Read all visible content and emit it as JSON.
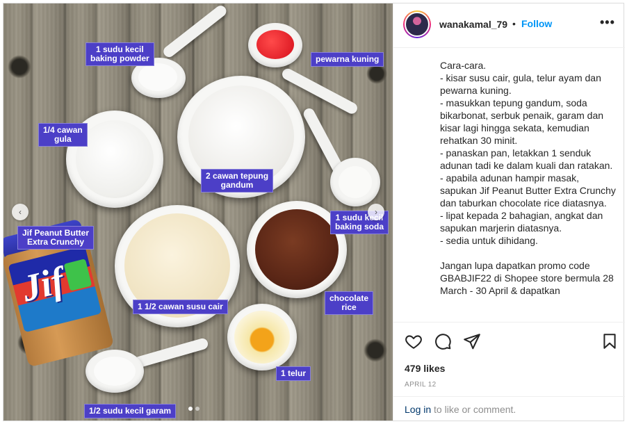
{
  "post": {
    "photo": {
      "labels": {
        "baking_powder": "1 sudu kecil\nbaking powder",
        "pewarna": "pewarna kuning",
        "gula": "1/4 cawan\ngula",
        "tepung": "2 cawan tepung\ngandum",
        "soda": "1 sudu kecil\nbaking soda",
        "jif": "Jif Peanut Butter\nExtra Crunchy",
        "susu": "1 1/2 cawan susu cair",
        "chocolate": "chocolate\nrice",
        "telur": "1 telur",
        "garam": "1/2 sudu kecil garam"
      },
      "jar_brand": "Jif",
      "nav": {
        "prev": "‹",
        "next": "›"
      },
      "dots_count": 2,
      "active_dot": 1
    },
    "header": {
      "username": "wanakamal_79",
      "separator": "•",
      "follow_label": "Follow",
      "more_label": "•••"
    },
    "caption": "Cara-cara.\n- kisar susu cair, gula, telur ayam dan pewarna kuning.\n- masukkan tepung gandum, soda bikarbonat, serbuk penaik, garam dan kisar lagi hingga sekata, kemudian rehatkan 30 minit.\n- panaskan pan, letakkan 1 senduk adunan tadi ke dalam kuali dan ratakan.\n- apabila adunan hampir masak, sapukan Jif Peanut Butter Extra Crunchy dan taburkan chocolate rice diatasnya.\n- lipat kepada 2 bahagian, angkat dan sapukan marjerin diatasnya.\n- sedia untuk dihidang.\n\nJangan lupa dapatkan promo code GBABJIF22 di Shopee store bermula 28 March - 30 April & dapatkan",
    "actions": {
      "icons": [
        "heart-icon",
        "comment-icon",
        "share-icon",
        "bookmark-icon"
      ],
      "likes": "479 likes",
      "date": "APRIL 12",
      "login_link": "Log in",
      "login_rest": " to like or comment."
    },
    "colors": {
      "label_bg": "#4c3fc7",
      "follow": "#0095f6",
      "link": "#00376b"
    }
  }
}
